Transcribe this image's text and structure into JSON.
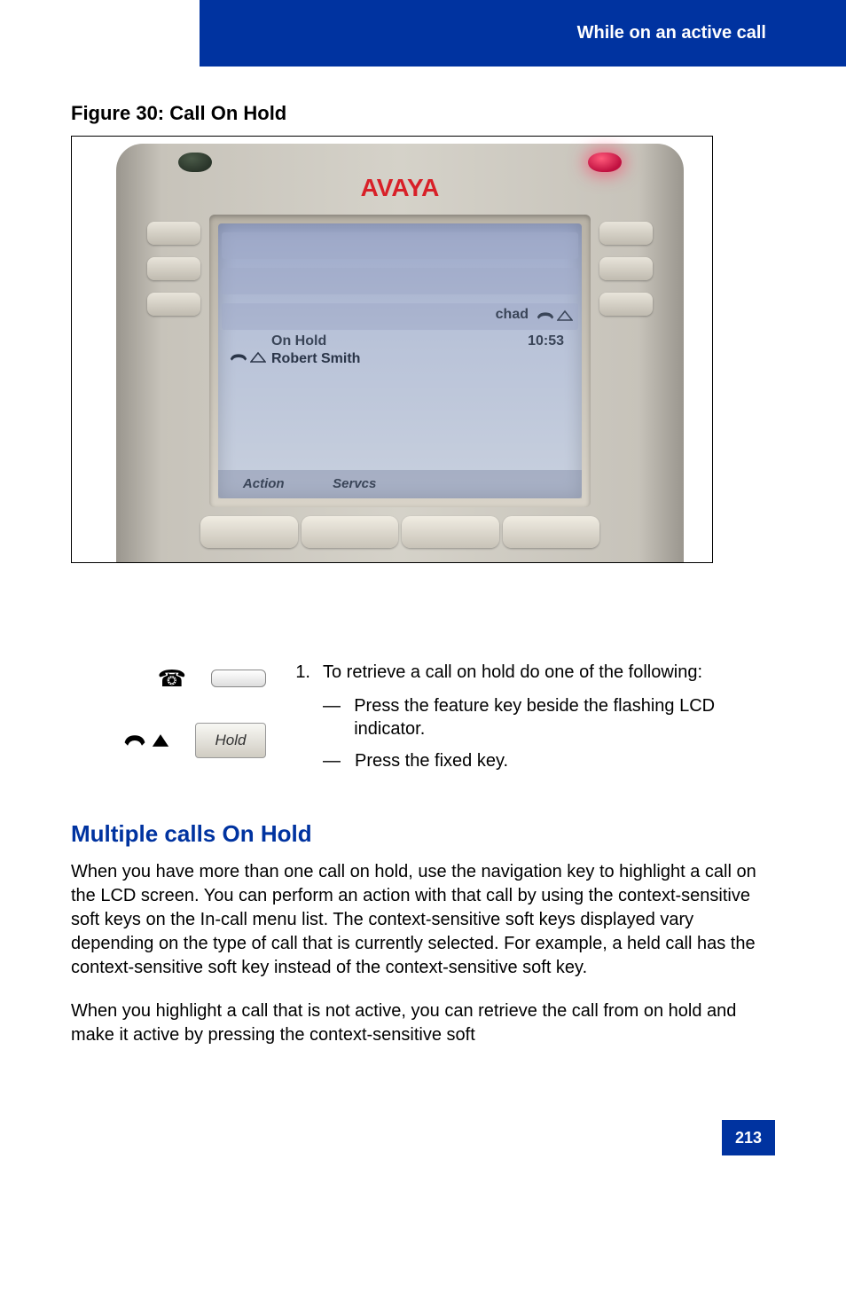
{
  "header": {
    "section_title": "While on an active call"
  },
  "figure": {
    "caption": "Figure 30:  Call On Hold",
    "phone": {
      "brand": "AVAYA",
      "lcd": {
        "user_label": "chad",
        "time": "10:53",
        "status_line": "On Hold",
        "caller_name": "Robert Smith",
        "softkeys": [
          "Action",
          "Servcs",
          "",
          ""
        ]
      }
    }
  },
  "instructions": {
    "step_number": "1.",
    "step_text": "To retrieve a call on hold do one of the following:",
    "options": [
      {
        "dash": "—",
        "before": "Press the ",
        "bold": "",
        "after": " feature key beside the flashing LCD indicator."
      },
      {
        "dash": "—",
        "before": " Press the ",
        "bold": "",
        "after": " fixed key."
      }
    ],
    "hold_key_label": "Hold"
  },
  "section": {
    "heading": "Multiple calls On Hold",
    "paragraph1": "When you have more than one call on hold, use the navigation key to highlight a call on the LCD screen. You can perform an action with that call by using the context-sensitive soft keys on the In-call menu list. The context-sensitive soft keys displayed vary depending on the type of call that is currently selected. For example, a held call has the context-sensitive soft key instead of the           context-sensitive soft key.",
    "paragraph2": "When you highlight a call that is not active, you can retrieve the call from on hold and make it active by pressing the              context-sensitive soft"
  },
  "page_number": "213"
}
